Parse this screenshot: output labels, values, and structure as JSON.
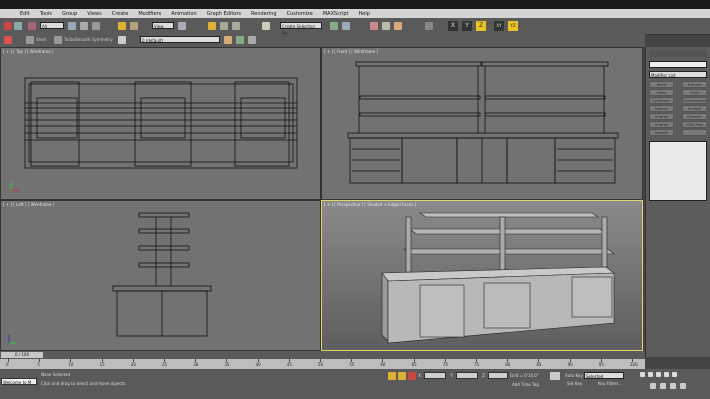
{
  "menu": [
    "Edit",
    "Tools",
    "Group",
    "Views",
    "Create",
    "Modifiers",
    "Animation",
    "Graph Editors",
    "Rendering",
    "Customize",
    "MAXScript",
    "Help"
  ],
  "toolbar": {
    "selection_filter": "All",
    "view_dropdown": "View",
    "named_selection": "Create Selection Se",
    "axis_x": "X",
    "axis_y": "Y",
    "axis_z": "Z",
    "axis_xy": "XY",
    "axis_yz": "YZ",
    "smooth": "Shell",
    "turbosmooth": "TurboSmooth",
    "symmetry": "Symmetry",
    "layer": "0 (default)"
  },
  "viewports": {
    "top": "[ + ] [ Top ] [ Wireframe ]",
    "front": "[ + ] [ Front ] [ Wireframe ]",
    "left": "[ + ] [ Left ] [ Wireframe ]",
    "perspective": "[ + ] [ Perspective ] [ Shaded + Edged Faces ]"
  },
  "command_panel": {
    "modifier_list": "Modifier List",
    "buttons": [
      "Bend",
      "Extrude",
      "Lathe",
      "Shell",
      "Symmetry",
      "TurboSmooth",
      "Normal",
      "Surface Select",
      "Unwrap",
      "Chamfer UVW",
      "Unwrap",
      "UVW Map",
      "Smooth",
      ""
    ]
  },
  "timeline": {
    "frame": "0 / 100",
    "ticks": [
      "0",
      "5",
      "10",
      "15",
      "20",
      "25",
      "30",
      "35",
      "40",
      "45",
      "50",
      "55",
      "60",
      "65",
      "70",
      "75",
      "80",
      "85",
      "90",
      "95",
      "100"
    ]
  },
  "status": {
    "maxscript": "Welcome to M",
    "selection": "None Selected",
    "prompt": "Click and drag to select and move objects",
    "x_label": "X:",
    "y_label": "Y:",
    "z_label": "Z:",
    "grid": "Grid = 0'10.0\"",
    "add_time_tag": "Add Time Tag",
    "auto_key": "Auto Key",
    "set_key": "Set Key",
    "key_mode": "Selected",
    "key_filters": "Key Filters..."
  }
}
